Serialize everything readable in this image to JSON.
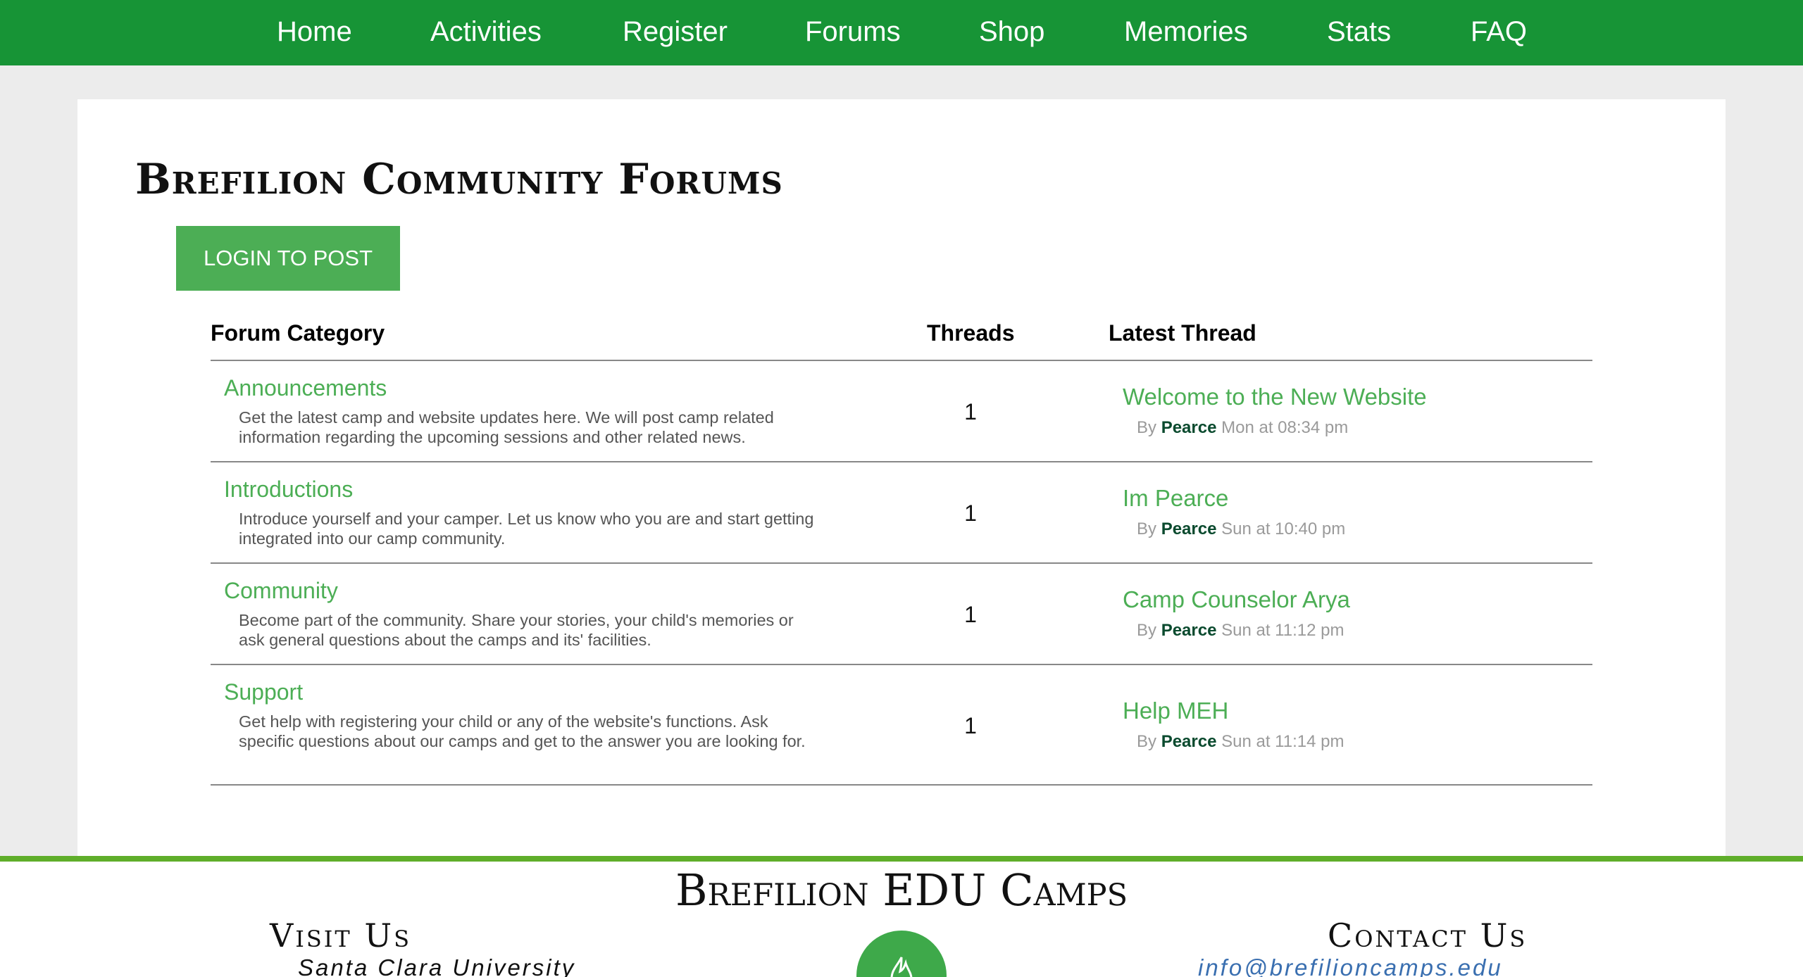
{
  "nav": {
    "items": [
      "Home",
      "Activities",
      "Register",
      "Forums",
      "Shop",
      "Memories",
      "Stats",
      "FAQ"
    ]
  },
  "main": {
    "title": "Brefilion Community Forums",
    "login_label": "LOGIN TO POST"
  },
  "table": {
    "headers": {
      "category": "Forum Category",
      "threads": "Threads",
      "latest": "Latest Thread"
    },
    "rows": [
      {
        "name": "Announcements",
        "description": "Get the latest camp and website updates here. We will post camp related information regarding the upcoming sessions and other related news.",
        "threads": "1",
        "latest_title": "Welcome to the New Website",
        "by": "By",
        "author": "Pearce",
        "time": "Mon at 08:34 pm"
      },
      {
        "name": "Introductions",
        "description": "Introduce yourself and your camper. Let us know who you are and start getting integrated into our camp community.",
        "threads": "1",
        "latest_title": "Im Pearce",
        "by": "By",
        "author": "Pearce",
        "time": "Sun at 10:40 pm"
      },
      {
        "name": "Community",
        "description": "Become part of the community. Share your stories, your child's memories or ask general questions about the camps and its' facilities.",
        "threads": "1",
        "latest_title": "Camp Counselor Arya",
        "by": "By",
        "author": "Pearce",
        "time": "Sun at 11:12 pm"
      },
      {
        "name": "Support",
        "description": "Get help with registering your child or any of the website's functions. Ask specific questions about our camps and get to the answer you are looking for.",
        "threads": "1",
        "latest_title": "Help MEH",
        "by": "By",
        "author": "Pearce",
        "time": "Sun at 11:14 pm"
      }
    ]
  },
  "footer": {
    "title": "Brefilion EDU Camps",
    "visit_heading": "Visit Us",
    "address": "Santa Clara University",
    "contact_heading": "Contact Us",
    "email": "info@brefilioncamps.edu",
    "logo_icon": "flame-logo-icon"
  },
  "colors": {
    "nav_bg": "#179436",
    "accent_green": "#4cae55",
    "footer_line": "#5fae2a",
    "author": "#0a4a2e",
    "email": "#3a6fb0"
  }
}
